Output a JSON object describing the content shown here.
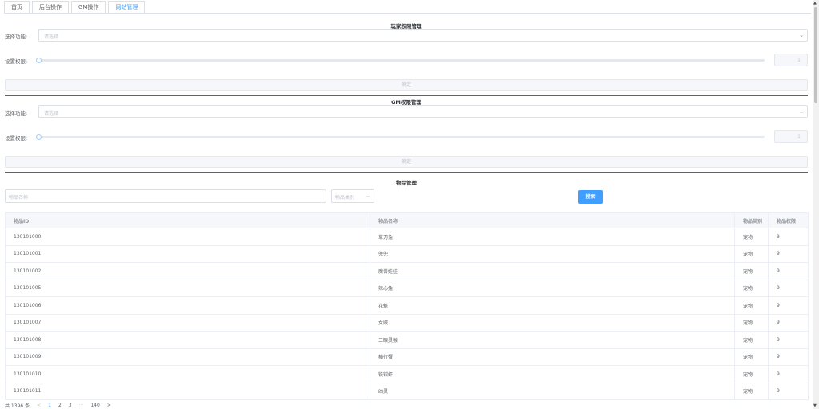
{
  "tabs": [
    {
      "label": "首页"
    },
    {
      "label": "后台操作"
    },
    {
      "label": "GM操作"
    },
    {
      "label": "网站管理"
    }
  ],
  "player_perm": {
    "title": "玩家权限管理",
    "select_label": "选择功能:",
    "select_placeholder": "请选择",
    "level_label": "设置权限:",
    "level_value": "1",
    "confirm_label": "确定"
  },
  "gm_perm": {
    "title": "GM权限管理",
    "select_label": "选择功能:",
    "select_placeholder": "请选择",
    "level_label": "设置权限:",
    "level_value": "1",
    "confirm_label": "确定"
  },
  "items": {
    "title": "物品管理",
    "name_placeholder": "物品名称",
    "category_placeholder": "物品类别",
    "search_label": "搜索",
    "columns": [
      "物品ID",
      "物品名称",
      "物品类别",
      "物品权限"
    ],
    "rows": [
      [
        "130101000",
        "草刀兔",
        "宠物",
        "9"
      ],
      [
        "130101001",
        "兜兜",
        "宠物",
        "9"
      ],
      [
        "130101002",
        "魔兽娃娃",
        "宠物",
        "9"
      ],
      [
        "130101005",
        "辣心兔",
        "宠物",
        "9"
      ],
      [
        "130101006",
        "花魁",
        "宠物",
        "9"
      ],
      [
        "130101007",
        "女贼",
        "宠物",
        "9"
      ],
      [
        "130101008",
        "三眼灵猴",
        "宠物",
        "9"
      ],
      [
        "130101009",
        "横行蟹",
        "宠物",
        "9"
      ],
      [
        "130101010",
        "铁钳虾",
        "宠物",
        "9"
      ],
      [
        "130101011",
        "凶灵",
        "宠物",
        "9"
      ]
    ]
  },
  "pagination": {
    "total": "共 1396 条",
    "prev": "<",
    "pages": [
      "1",
      "2",
      "3"
    ],
    "ellipsis": "···",
    "last": "140",
    "next": ">"
  }
}
